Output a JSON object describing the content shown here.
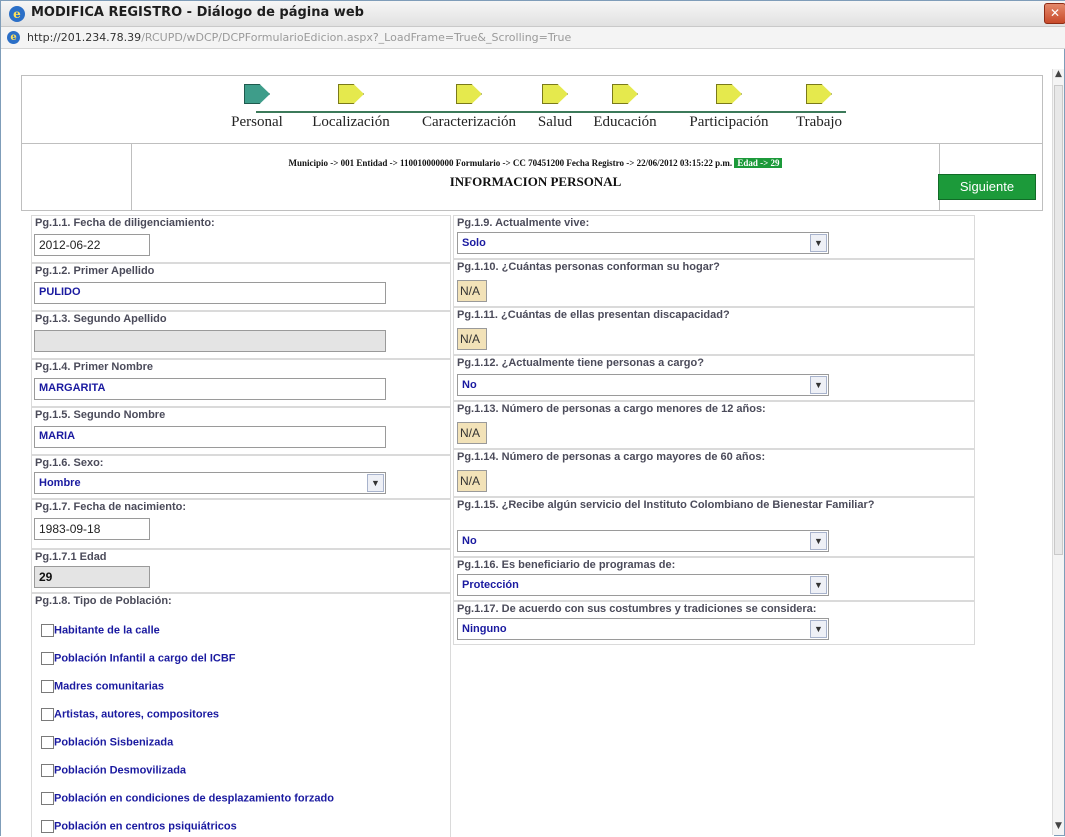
{
  "window": {
    "title": "MODIFICA REGISTRO - Diálogo de página web",
    "close_glyph": "✕",
    "url_host": "http://201.234.78.39",
    "url_path": "/RCUPD/wDCP/DCPFormularioEdicion.aspx?_LoadFrame=True&_Scrolling=True"
  },
  "steps": [
    {
      "label": "Personal",
      "icon": "step-arrow-current"
    },
    {
      "label": "Localización",
      "icon": "step-arrow"
    },
    {
      "label": "Caracterización",
      "icon": "step-arrow"
    },
    {
      "label": "Salud",
      "icon": "step-arrow"
    },
    {
      "label": "Educación",
      "icon": "step-arrow"
    },
    {
      "label": "Participación",
      "icon": "step-arrow"
    },
    {
      "label": "Trabajo",
      "icon": "step-arrow"
    }
  ],
  "header": {
    "breadcrumb": "Municipio -> 001 Entidad -> 110010000000 Formulario -> CC 70451200 Fecha Registro -> 22/06/2012 03:15:22 p.m.",
    "age_badge": "Edad -> 29",
    "section_title": "INFORMACION PERSONAL",
    "next_button": "Siguiente"
  },
  "left": {
    "f1": {
      "label": "Pg.1.1. Fecha de diligenciamiento:",
      "value": "2012-06-22"
    },
    "f2": {
      "label": "Pg.1.2. Primer Apellido",
      "value": "PULIDO"
    },
    "f3": {
      "label": "Pg.1.3. Segundo Apellido",
      "value": ""
    },
    "f4": {
      "label": "Pg.1.4. Primer Nombre",
      "value": "MARGARITA"
    },
    "f5": {
      "label": "Pg.1.5. Segundo Nombre",
      "value": "MARIA"
    },
    "f6": {
      "label": "Pg.1.6. Sexo:",
      "value": "Hombre"
    },
    "f7": {
      "label": "Pg.1.7. Fecha de nacimiento:",
      "value": "1983-09-18"
    },
    "f71": {
      "label": "Pg.1.7.1 Edad",
      "value": "29"
    },
    "f8": {
      "label": "Pg.1.8. Tipo de Población:",
      "options": [
        "Habitante de la calle",
        "Población Infantil a cargo del ICBF",
        "Madres comunitarias",
        "Artistas, autores, compositores",
        "Población Sisbenizada",
        "Población Desmovilizada",
        "Población en condiciones de desplazamiento forzado",
        "Población en centros psiquiátricos"
      ]
    }
  },
  "right": {
    "f9": {
      "label": "Pg.1.9. Actualmente vive:",
      "value": "Solo"
    },
    "f10": {
      "label": "Pg.1.10. ¿Cuántas personas conforman su hogar?",
      "value": "N/A"
    },
    "f11": {
      "label": "Pg.1.11. ¿Cuántas de ellas presentan discapacidad?",
      "value": "N/A"
    },
    "f12": {
      "label": "Pg.1.12. ¿Actualmente tiene personas a cargo?",
      "value": "No"
    },
    "f13": {
      "label": "Pg.1.13. Número de personas a cargo menores de 12 años:",
      "value": "N/A"
    },
    "f14": {
      "label": "Pg.1.14. Número de personas a cargo mayores de 60 años:",
      "value": "N/A"
    },
    "f15": {
      "label": "Pg.1.15. ¿Recibe algún servicio del Instituto Colombiano de Bienestar Familiar?",
      "value": "No"
    },
    "f16": {
      "label": "Pg.1.16. Es beneficiario de programas de:",
      "value": "Protección"
    },
    "f17": {
      "label": "Pg.1.17. De acuerdo con sus costumbres y tradiciones se considera:",
      "value": "Ninguno"
    }
  },
  "glyphs": {
    "dropdown": "▼",
    "scroll_up": "▲",
    "scroll_down": "▼"
  },
  "colors": {
    "accent_green": "#1c9a3a",
    "step_current": "#3e9d8a",
    "step_pending": "#e5e94d",
    "na_fill": "#f2e2b8",
    "value_text": "#1a1aa0"
  }
}
